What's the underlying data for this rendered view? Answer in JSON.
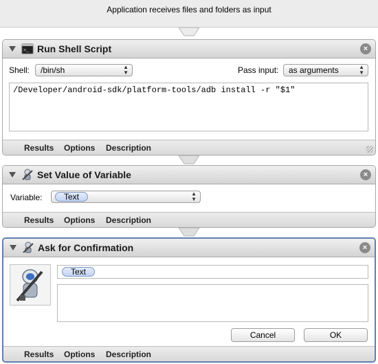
{
  "workflow": {
    "input_banner": "Application receives files and folders as input"
  },
  "actions": [
    {
      "title": "Run Shell Script",
      "icon": "terminal-icon",
      "shell_label": "Shell:",
      "shell_value": "/bin/sh",
      "pass_input_label": "Pass input:",
      "pass_input_value": "as arguments",
      "script": "/Developer/android-sdk/platform-tools/adb install -r \"$1\"",
      "footer": {
        "results": "Results",
        "options": "Options",
        "description": "Description"
      }
    },
    {
      "title": "Set Value of Variable",
      "icon": "robot-icon",
      "variable_label": "Variable:",
      "variable_value": "Text",
      "footer": {
        "results": "Results",
        "options": "Options",
        "description": "Description"
      }
    },
    {
      "title": "Ask for Confirmation",
      "icon": "robot-icon",
      "message_token": "Text",
      "cancel_label": "Cancel",
      "ok_label": "OK",
      "footer": {
        "results": "Results",
        "options": "Options",
        "description": "Description"
      }
    }
  ],
  "colors": {
    "selection_border": "#5f7fae",
    "token_fill": "#c4d4f3"
  }
}
